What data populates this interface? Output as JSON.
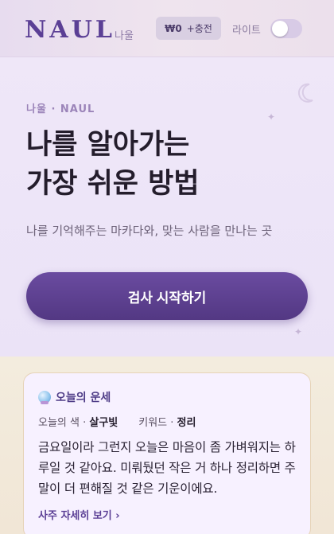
{
  "header": {
    "logo": "NAUL",
    "logo_sub": "나울",
    "wallet": {
      "balance": "₩0",
      "charge_label": "+충전"
    },
    "theme_label": "라이트",
    "theme_toggle_on": false
  },
  "hero": {
    "eyebrow": "나울 · NAUL",
    "headline_line1": "나를 알아가는",
    "headline_line2": "가장 쉬운 방법",
    "tagline": "나를 기억해주는 마카다와, 맞는 사람을 만나는 곳",
    "cta_label": "검사 시작하기"
  },
  "fortune": {
    "title": "오늘의 운세",
    "color_label": "오늘의 색 · ",
    "color_value": "살구빛",
    "keyword_label": "키워드 · ",
    "keyword_value": "정리",
    "body": "금요일이라 그런지 오늘은 마음이 좀 가벼워지는 하루일 것 같아요. 미뤄뒀던 작은 거 하나 정리하면 주말이 더 편해질 것 같은 기운이에요.",
    "more_link": "사주 자세히 보기 ›"
  },
  "colors": {
    "brand": "#5b3f95",
    "cta": "#533883",
    "card_border": "#e6d3b8"
  }
}
